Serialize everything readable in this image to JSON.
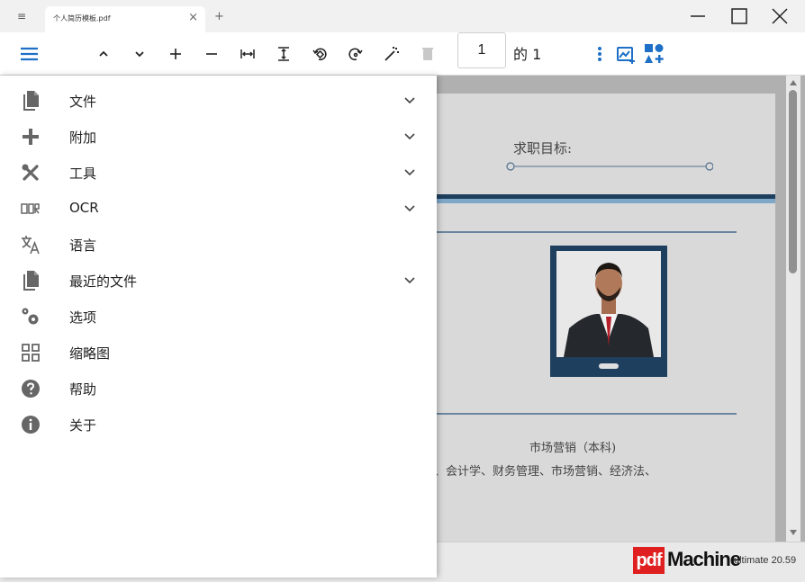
{
  "window": {
    "tab_menu_glyph": "≡",
    "tab_title": "个人简历模板.pdf",
    "tab_close_glyph": "×",
    "new_tab_glyph": "+"
  },
  "toolbar": {
    "page_number": "1",
    "page_of": "的 1",
    "icons": [
      "hamburger-icon",
      "chevron-up-icon",
      "chevron-down-icon",
      "zoom-in-icon",
      "zoom-out-icon",
      "fit-width-icon",
      "fit-height-icon",
      "rotate-left-icon",
      "rotate-right-icon",
      "magic-wand-icon",
      "trash-icon",
      "more-vert-icon",
      "insert-image-icon",
      "add-shapes-icon"
    ],
    "accent_color": "#1e6fc6"
  },
  "menu": {
    "items": [
      {
        "label": "文件",
        "icon": "file-icon",
        "expandable": true
      },
      {
        "label": "附加",
        "icon": "plus-icon",
        "expandable": true
      },
      {
        "label": "工具",
        "icon": "tools-icon",
        "expandable": true
      },
      {
        "label": "OCR",
        "icon": "ocr-icon",
        "expandable": true
      },
      {
        "label": "语言",
        "icon": "translate-icon",
        "expandable": false
      },
      {
        "label": "最近的文件",
        "icon": "recent-files-icon",
        "expandable": true
      },
      {
        "label": "选项",
        "icon": "settings-icon",
        "expandable": false
      },
      {
        "label": "缩略图",
        "icon": "thumbnails-icon",
        "expandable": false
      },
      {
        "label": "帮助",
        "icon": "help-icon",
        "expandable": false
      },
      {
        "label": "关于",
        "icon": "info-icon",
        "expandable": false
      }
    ]
  },
  "document": {
    "job_goal": "求职目标:",
    "major": "市场营销（本科)",
    "courses": "、会计学、财务管理、市场营销、经济法、",
    "header_band_color": "#1f3f5e"
  },
  "footer": {
    "brand_pdf": "pdf",
    "brand_machine": "Machine",
    "version": "ultimate 20.59"
  }
}
